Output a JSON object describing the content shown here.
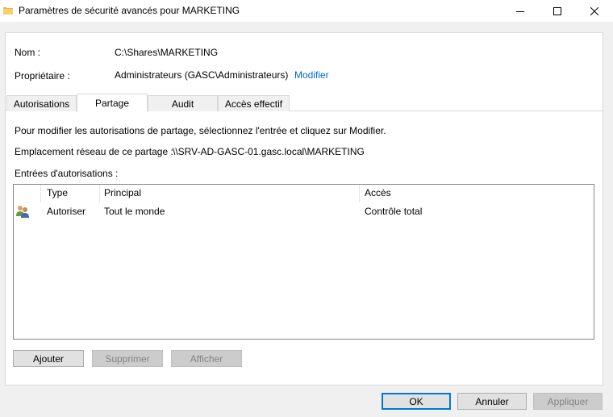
{
  "window": {
    "title": "Paramètres de sécurité avancés pour MARKETING"
  },
  "details": {
    "name_label": "Nom :",
    "name_value": "C:\\Shares\\MARKETING",
    "owner_label": "Propriétaire :",
    "owner_value": "Administrateurs (GASC\\Administrateurs)",
    "owner_link": "Modifier"
  },
  "tabs": [
    {
      "label": "Autorisations",
      "active": false
    },
    {
      "label": "Partage",
      "active": true
    },
    {
      "label": "Audit",
      "active": false
    },
    {
      "label": "Accès effectif",
      "active": false
    }
  ],
  "share": {
    "instruction": "Pour modifier les autorisations de partage, sélectionnez l'entrée et cliquez sur Modifier.",
    "location_label": "Emplacement réseau de ce partage :",
    "location_value": "\\\\SRV-AD-GASC-01.gasc.local\\MARKETING",
    "entries_label": "Entrées d'autorisations :"
  },
  "table": {
    "columns": [
      "Type",
      "Principal",
      "Accès"
    ],
    "rows": [
      {
        "icon": "users-icon",
        "type": "Autoriser",
        "principal": "Tout le monde",
        "access": "Contrôle total"
      }
    ]
  },
  "entry_buttons": {
    "add": "Ajouter",
    "remove": "Supprimer",
    "view": "Afficher"
  },
  "dialog_buttons": {
    "ok": "OK",
    "cancel": "Annuler",
    "apply": "Appliquer"
  },
  "colors": {
    "link": "#0066cc",
    "default_button_border": "#0078d7"
  }
}
